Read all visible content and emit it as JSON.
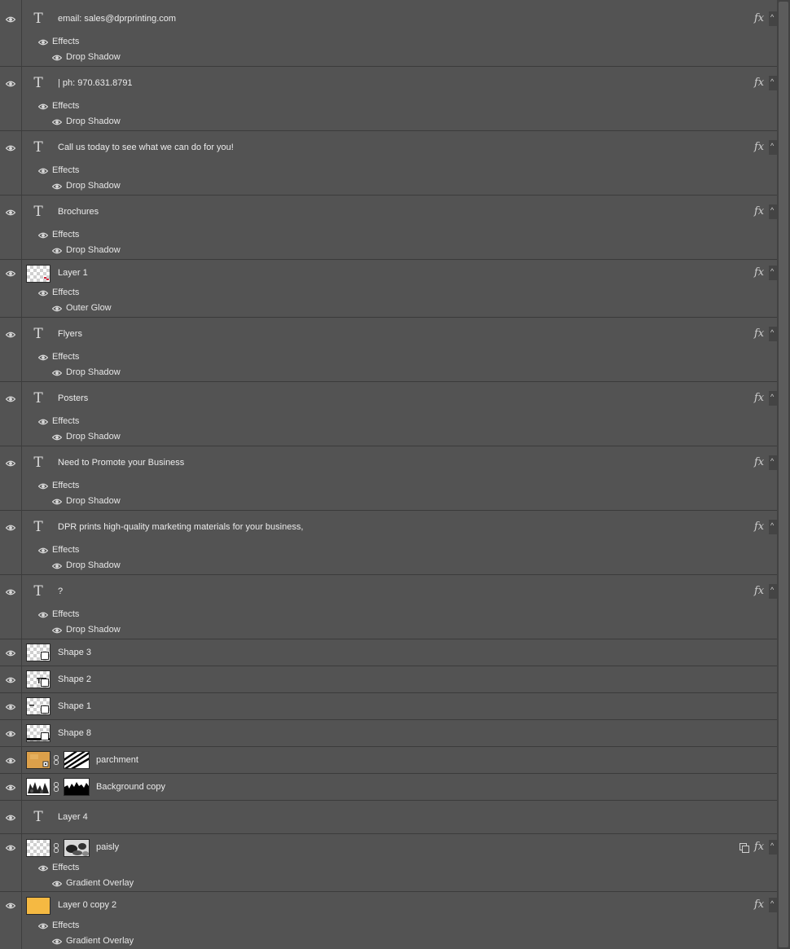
{
  "panel": "layers",
  "colors": {
    "panel_bg": "#535353",
    "separator": "#3b3b3b",
    "text": "#e6e6e6",
    "swatch_orange": "#f5b942"
  },
  "icons": {
    "visibility": "eye-icon",
    "text_layer": "type-layer-icon",
    "effects": "fx-icon",
    "collapse": "caret-up-icon",
    "mask_link": "chain-link-icon",
    "smart_object": "smart-object-icon"
  },
  "labels": {
    "type_glyph": "T",
    "fx": "fx",
    "caret": "^"
  },
  "layers": [
    {
      "name": "email: sales@dprprinting.com",
      "kind": "text",
      "fx": true,
      "effects_label": "Effects",
      "effects": [
        "Drop Shadow"
      ]
    },
    {
      "name": "| ph: 970.631.8791",
      "kind": "text",
      "fx": true,
      "effects_label": "Effects",
      "effects": [
        "Drop Shadow"
      ]
    },
    {
      "name": "Call us today  to see what we can do for you!",
      "kind": "text",
      "fx": true,
      "effects_label": "Effects",
      "effects": [
        "Drop Shadow"
      ]
    },
    {
      "name": "Brochures",
      "kind": "text",
      "fx": true,
      "effects_label": "Effects",
      "effects": [
        "Drop Shadow"
      ]
    },
    {
      "name": "Layer 1",
      "kind": "pixel",
      "fx": true,
      "effects_label": "Effects",
      "effects": [
        "Outer Glow"
      ]
    },
    {
      "name": "Flyers",
      "kind": "text",
      "fx": true,
      "effects_label": "Effects",
      "effects": [
        "Drop Shadow"
      ]
    },
    {
      "name": "Posters",
      "kind": "text",
      "fx": true,
      "effects_label": "Effects",
      "effects": [
        "Drop Shadow"
      ]
    },
    {
      "name": "Need to Promote your  Business",
      "kind": "text",
      "fx": true,
      "effects_label": "Effects",
      "effects": [
        "Drop Shadow"
      ]
    },
    {
      "name": "DPR prints high-quality marketing materials for  your business,",
      "kind": "text",
      "fx": true,
      "effects_label": "Effects",
      "effects": [
        "Drop Shadow"
      ]
    },
    {
      "name": "?",
      "kind": "text",
      "fx": true,
      "effects_label": "Effects",
      "effects": [
        "Drop Shadow"
      ]
    },
    {
      "name": "Shape 3",
      "kind": "shape",
      "fx": false
    },
    {
      "name": "Shape 2",
      "kind": "shape",
      "fx": false
    },
    {
      "name": "Shape 1",
      "kind": "shape",
      "fx": false
    },
    {
      "name": "Shape 8",
      "kind": "shape",
      "fx": false
    },
    {
      "name": "parchment",
      "kind": "masked-smart",
      "fx": false
    },
    {
      "name": "Background copy",
      "kind": "masked",
      "fx": false
    },
    {
      "name": "Layer 4",
      "kind": "text",
      "fx": false
    },
    {
      "name": "paisly",
      "kind": "masked-smart",
      "fx": true,
      "effects_label": "Effects",
      "effects": [
        "Gradient Overlay"
      ]
    },
    {
      "name": "Layer 0 copy 2",
      "kind": "fill",
      "fx": true,
      "effects_label": "Effects",
      "effects": [
        "Gradient Overlay"
      ]
    }
  ]
}
